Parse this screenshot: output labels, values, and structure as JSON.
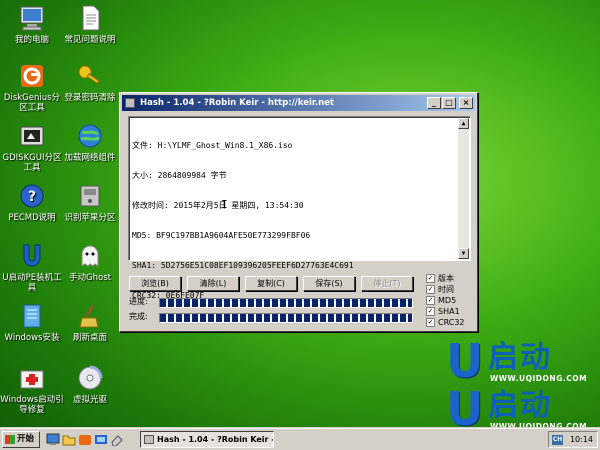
{
  "desktop": {
    "icons": [
      {
        "label": "我的电脑"
      },
      {
        "label": "常见问题说明"
      },
      {
        "label": "DiskGenius分区工具"
      },
      {
        "label": "登录密码清除"
      },
      {
        "label": "GDISKGUI分区工具"
      },
      {
        "label": "加载网络组件"
      },
      {
        "label": "PECMD说明"
      },
      {
        "label": "识别苹果分区"
      },
      {
        "label": "U启动PE装机工具"
      },
      {
        "label": "手动Ghost"
      },
      {
        "label": "Windows安装"
      },
      {
        "label": "刷新桌面"
      },
      {
        "label": "Windows启动引导修复"
      },
      {
        "label": "虚拟光驱"
      }
    ]
  },
  "brand": {
    "letter": "U",
    "name": "启动",
    "url": "WWW.UQIDONG.COM",
    "color": "#0d5fb8"
  },
  "window": {
    "title": "Hash - 1.04 - ?Robin Keir - http://keir.net",
    "controls": {
      "minimize": "_",
      "maximize": "□",
      "close": "×"
    },
    "output_lines": [
      "文件: H:\\YLMF_Ghost_Win8.1_X86.iso",
      "大小: 2864809984 字节",
      "修改时间: 2015年2月5日 星期四, 13:54:30",
      "MD5: BF9C197BB1A9604AFE50E773299FBF06",
      "SHA1: 5D2756E51C08EF109396205FEEF6D27763E4C691",
      "CRC32: 0E6FE07F"
    ],
    "buttons": {
      "browse": "浏览(B)",
      "clear": "清除(L)",
      "copy": "复制(C)",
      "save": "保存(S)",
      "stop": "停止(T)"
    },
    "options": [
      {
        "label": "版本",
        "checked": true
      },
      {
        "label": "时间",
        "checked": true
      },
      {
        "label": "MD5",
        "checked": true
      },
      {
        "label": "SHA1",
        "checked": true
      },
      {
        "label": "CRC32",
        "checked": true
      }
    ],
    "progress": {
      "label": "进度:",
      "value": 1.0
    },
    "complete": {
      "label": "完成:",
      "value": 1.0
    }
  },
  "taskbar": {
    "start_label": "开始",
    "task_label": "Hash - 1.04 - ?Robin Keir - ...",
    "ime": "CH",
    "clock": "10:14"
  }
}
